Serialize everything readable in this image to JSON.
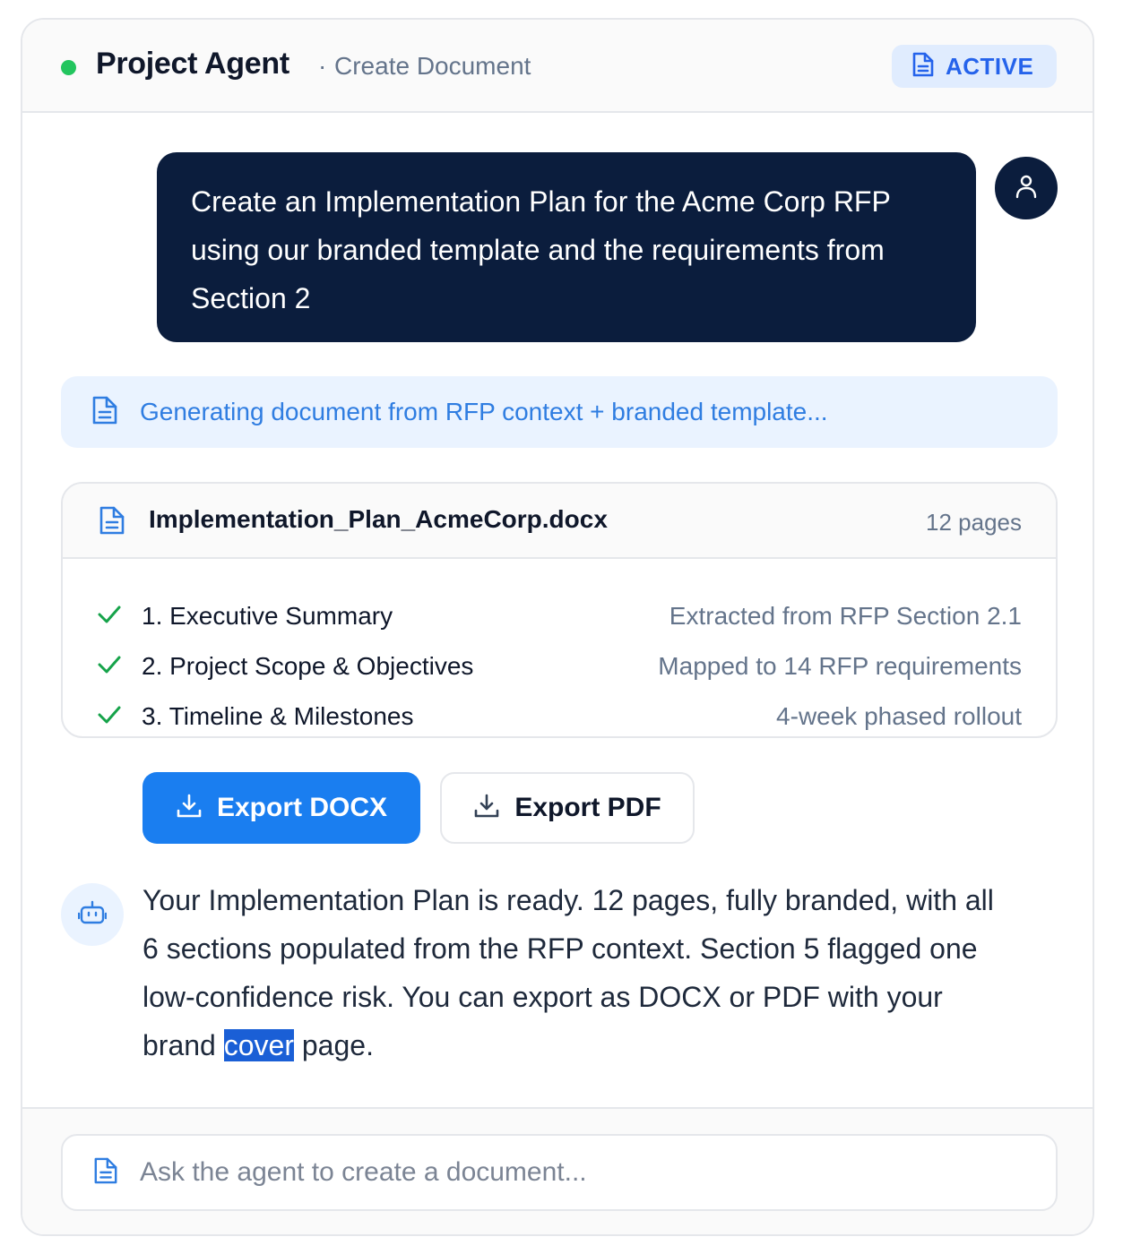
{
  "header": {
    "title": "Project Agent",
    "separator": "·",
    "subtitle": "Create Document",
    "badge_label": "ACTIVE",
    "status_color": "#22c55e"
  },
  "user_message": {
    "text": "Create an Implementation Plan for the Acme Corp RFP using our branded template and the requirements from Section 2",
    "avatar_icon": "user-icon"
  },
  "generation_status": {
    "text": "Generating document from RFP context + branded template..."
  },
  "document": {
    "filename": "Implementation_Plan_AcmeCorp.docx",
    "pages": "12 pages",
    "sections": [
      {
        "title": "1. Executive Summary",
        "note": "Extracted from RFP Section 2.1"
      },
      {
        "title": "2. Project Scope & Objectives",
        "note": "Mapped to 14 RFP requirements"
      },
      {
        "title": "3. Timeline & Milestones",
        "note": "4-week phased rollout"
      }
    ]
  },
  "actions": {
    "export_docx": "Export DOCX",
    "export_pdf": "Export PDF"
  },
  "agent_message": {
    "text_before": "Your Implementation Plan is ready. 12 pages, fully branded, with all 6 sections populated from the RFP context. Section 5 flagged one low-confidence risk. You can export as DOCX or PDF with your brand ",
    "text_selected": "cover",
    "text_after": " page.",
    "avatar_icon": "bot-icon"
  },
  "composer": {
    "placeholder": "Ask the agent to create a document..."
  },
  "colors": {
    "primary": "#1a7ef0",
    "navy": "#0b1d3d",
    "accent_text": "#2f7de1",
    "check": "#16a34a"
  }
}
